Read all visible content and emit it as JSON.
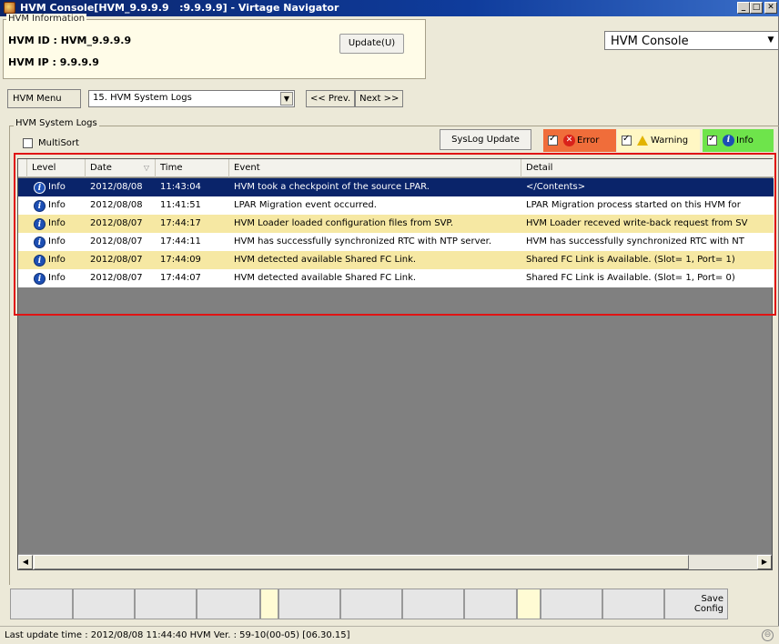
{
  "window": {
    "title": "HVM Console[HVM_9.9.9.9   :9.9.9.9] - Virtage Navigator"
  },
  "info": {
    "legend": "HVM Information",
    "id_line": "HVM ID : HVM_9.9.9.9",
    "ip_line": "HVM IP : 9.9.9.9",
    "update_label": "Update(U)"
  },
  "console_select": {
    "value": "HVM Console"
  },
  "menu": {
    "menu_label": "HVM Menu",
    "selected_log": "15. HVM System Logs",
    "prev_label": "<< Prev.",
    "next_label": "Next >>"
  },
  "logs": {
    "legend": "HVM System Logs",
    "multisort_label": "MultiSort",
    "multisort_checked": false,
    "syslog_update_label": "SysLog Update",
    "filters": {
      "error": {
        "label": "Error",
        "checked": true
      },
      "warning": {
        "label": "Warning",
        "checked": true
      },
      "info": {
        "label": "Info",
        "checked": true
      }
    },
    "columns": [
      "",
      "Level",
      "Date",
      "Time",
      "Event",
      "Detail"
    ],
    "rows": [
      {
        "level": "Info",
        "date": "2012/08/08",
        "time": "11:43:04",
        "event": "HVM took a checkpoint of the source LPAR.",
        "detail": "</Contents>"
      },
      {
        "level": "Info",
        "date": "2012/08/08",
        "time": "11:41:51",
        "event": "LPAR Migration event occurred.",
        "detail": "LPAR Migration process started on this HVM for"
      },
      {
        "level": "Info",
        "date": "2012/08/07",
        "time": "17:44:17",
        "event": "HVM Loader loaded configuration files from SVP.",
        "detail": "HVM Loader receved write-back request from SV"
      },
      {
        "level": "Info",
        "date": "2012/08/07",
        "time": "17:44:11",
        "event": "HVM has successfully synchronized RTC with NTP server.",
        "detail": "HVM has successfully synchronized RTC with NT"
      },
      {
        "level": "Info",
        "date": "2012/08/07",
        "time": "17:44:09",
        "event": "HVM detected available Shared FC Link.",
        "detail": "Shared FC Link is Available. (Slot= 1, Port= 1)"
      },
      {
        "level": "Info",
        "date": "2012/08/07",
        "time": "17:44:07",
        "event": "HVM detected available Shared FC Link.",
        "detail": "Shared FC Link is Available. (Slot= 1, Port= 0)"
      }
    ]
  },
  "function_keys": {
    "save_config_line1": "Save",
    "save_config_line2": "Config"
  },
  "status": {
    "text": "Last update time : 2012/08/08 11:44:40   HVM Ver. : 59-10(00-05) [06.30.15]"
  }
}
